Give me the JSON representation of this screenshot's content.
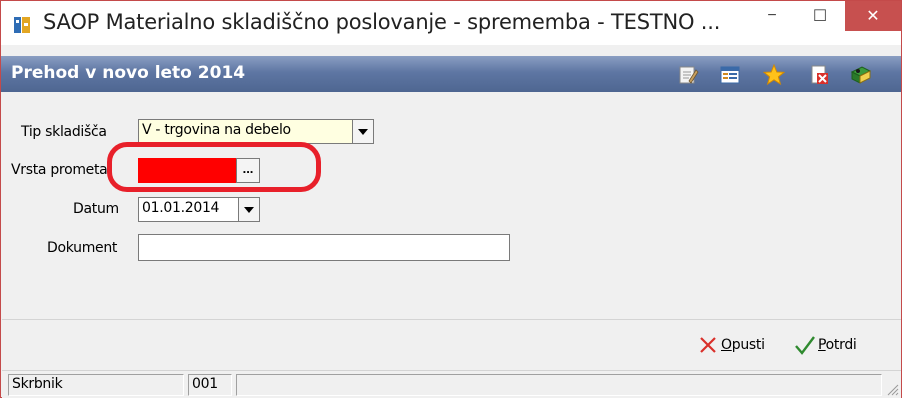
{
  "window": {
    "title": "SAOP Materialno skladiščno poslovanje - sprememba - TESTNO ...",
    "minimize_label": "−",
    "maximize_label": "☐",
    "close_label": "✕"
  },
  "header": {
    "title": "Prehod v novo leto 2014",
    "icons": [
      "edit-icon",
      "list-icon",
      "star-icon",
      "delete-icon",
      "book-icon"
    ]
  },
  "form": {
    "tip_skladisca": {
      "label": "Tip skladišča",
      "value": "V - trgovina na debelo"
    },
    "vrsta_prometa": {
      "label": "Vrsta prometa",
      "value": "",
      "button_label": "..."
    },
    "datum": {
      "label": "Datum",
      "value": "01.01.2014"
    },
    "dokument": {
      "label": "Dokument",
      "value": ""
    }
  },
  "actions": {
    "cancel": {
      "underlined": "O",
      "rest": "pusti"
    },
    "confirm": {
      "underlined": "P",
      "rest": "otrdi"
    }
  },
  "statusbar": {
    "user": "Skrbnik",
    "code": "001",
    "message": ""
  },
  "colors": {
    "header_bar": "#5e76a3",
    "highlight_red": "#ff0000",
    "selected_field": "#ffffe1",
    "close_button": "#c7504f"
  }
}
